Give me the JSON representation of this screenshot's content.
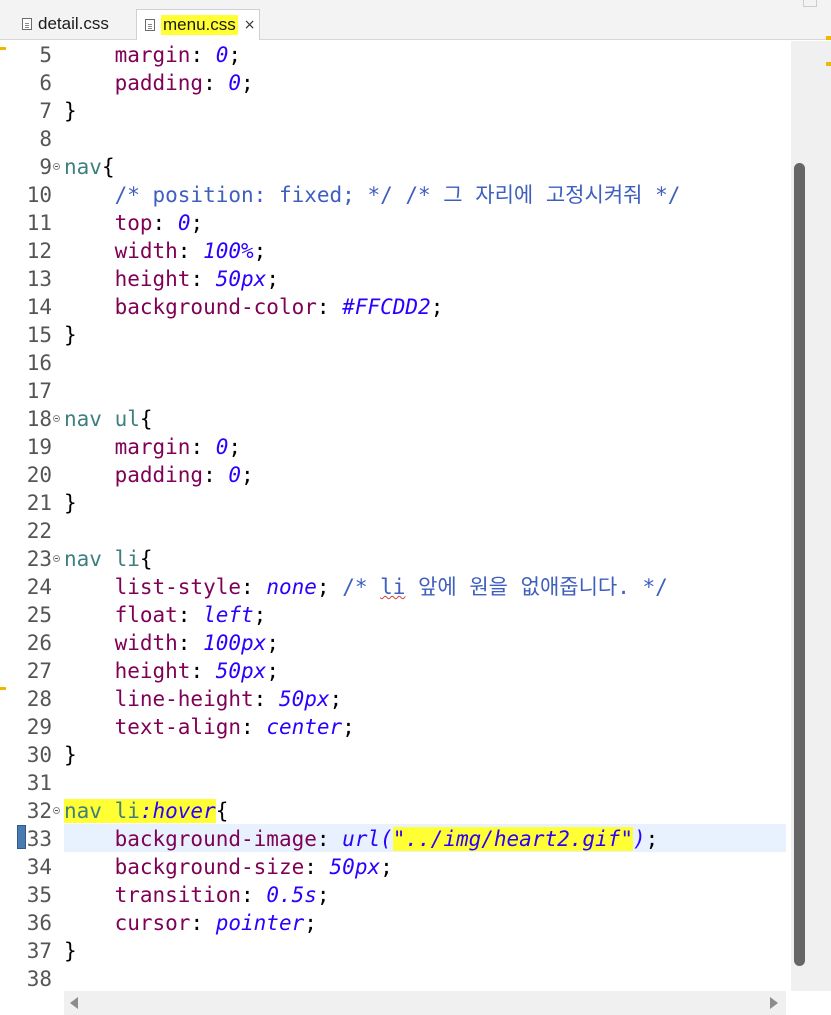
{
  "tabs": [
    {
      "label": "detail.css",
      "active": false
    },
    {
      "label": "menu.css",
      "active": true,
      "close": "×"
    }
  ],
  "editor": {
    "line_numbers": [
      "5",
      "6",
      "7",
      "8",
      "9",
      "10",
      "11",
      "12",
      "13",
      "14",
      "15",
      "16",
      "17",
      "18",
      "19",
      "20",
      "21",
      "22",
      "23",
      "24",
      "25",
      "26",
      "27",
      "28",
      "29",
      "30",
      "31",
      "32",
      "33",
      "34",
      "35",
      "36",
      "37",
      "38"
    ],
    "code": {
      "l5": {
        "prop": "margin",
        "sep": ": ",
        "val": "0",
        "end": ";"
      },
      "l6": {
        "prop": "padding",
        "sep": ": ",
        "val": "0",
        "end": ";"
      },
      "l7": {
        "brace": "}"
      },
      "l9": {
        "selector": "nav",
        "brace": "{"
      },
      "l10": {
        "comment": "/* position: fixed; */ /* 그 자리에 고정시켜줘 */"
      },
      "l11": {
        "prop": "top",
        "sep": ": ",
        "val": "0",
        "end": ";"
      },
      "l12": {
        "prop": "width",
        "sep": ": ",
        "val": "100%",
        "end": ";"
      },
      "l13": {
        "prop": "height",
        "sep": ": ",
        "val": "50px",
        "end": ";"
      },
      "l14": {
        "prop": "background-color",
        "sep": ": ",
        "val": "#FFCDD2",
        "end": ";"
      },
      "l15": {
        "brace": "}"
      },
      "l18": {
        "selector": "nav ul",
        "brace": "{"
      },
      "l19": {
        "prop": "margin",
        "sep": ": ",
        "val": "0",
        "end": ";"
      },
      "l20": {
        "prop": "padding",
        "sep": ": ",
        "val": "0",
        "end": ";"
      },
      "l21": {
        "brace": "}"
      },
      "l23": {
        "selector": "nav li",
        "brace": "{"
      },
      "l24": {
        "prop": "list-style",
        "sep": ": ",
        "val": "none",
        "end": ";",
        "comment_a": " /* ",
        "comment_li": "li",
        "comment_b": " 앞에 원을 없애줍니다. */"
      },
      "l25": {
        "prop": "float",
        "sep": ": ",
        "val": "left",
        "end": ";"
      },
      "l26": {
        "prop": "width",
        "sep": ": ",
        "val": "100px",
        "end": ";"
      },
      "l27": {
        "prop": "height",
        "sep": ": ",
        "val": "50px",
        "end": ";"
      },
      "l28": {
        "prop": "line-height",
        "sep": ": ",
        "val": "50px",
        "end": ";"
      },
      "l29": {
        "prop": "text-align",
        "sep": ": ",
        "val": "center",
        "end": ";"
      },
      "l30": {
        "brace": "}"
      },
      "l32": {
        "selector": "nav li",
        "pseudo": ":hover",
        "brace": "{"
      },
      "l33": {
        "prop": "background-image",
        "sep": ": ",
        "val_a": "url(",
        "val_str": "\"../img/heart2.gif\"",
        "val_b": ")",
        "end": ";"
      },
      "l34": {
        "prop": "background-size",
        "sep": ": ",
        "val": "50px",
        "end": ";"
      },
      "l35": {
        "prop": "transition",
        "sep": ": ",
        "val": "0.5s",
        "end": ";"
      },
      "l36": {
        "prop": "cursor",
        "sep": ": ",
        "val": "pointer",
        "end": ";"
      },
      "l37": {
        "brace": "}"
      }
    },
    "colors": {
      "property": "#7f0055",
      "value": "#2a00ff",
      "comment": "#3f5fbf",
      "selector": "#3f7f7f",
      "highlight": "#ffff33",
      "current_line": "#e8f2fe"
    }
  }
}
